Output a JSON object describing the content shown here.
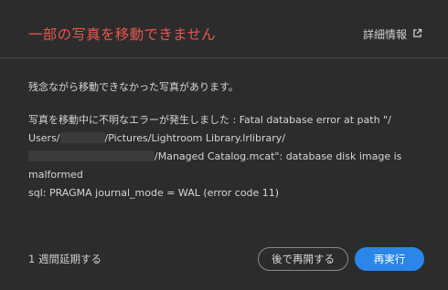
{
  "dialog": {
    "title": "一部の写真を移動できません",
    "details_link": "詳細情報",
    "message_intro": "残念ながら移動できなかった写真があります。",
    "error_lines": {
      "l1": "写真を移動中に不明なエラーが発生しました : Fatal database error at path \"/",
      "l2a": "Users/",
      "l2b": "/Pictures/Lightroom Library.lrlibrary/",
      "l3b": "/Managed Catalog.mcat\": database disk image is",
      "l4": "malformed",
      "l5": "sql: PRAGMA journal_mode = WAL (error code 11)"
    },
    "snooze_link": "1 週間延期する",
    "resume_later_button": "後で再開する",
    "retry_button": "再実行"
  },
  "colors": {
    "background": "#2c2c2c",
    "title": "#e8574f",
    "primary_button": "#2a86e8"
  },
  "icons": {
    "details": "external-link-icon"
  }
}
